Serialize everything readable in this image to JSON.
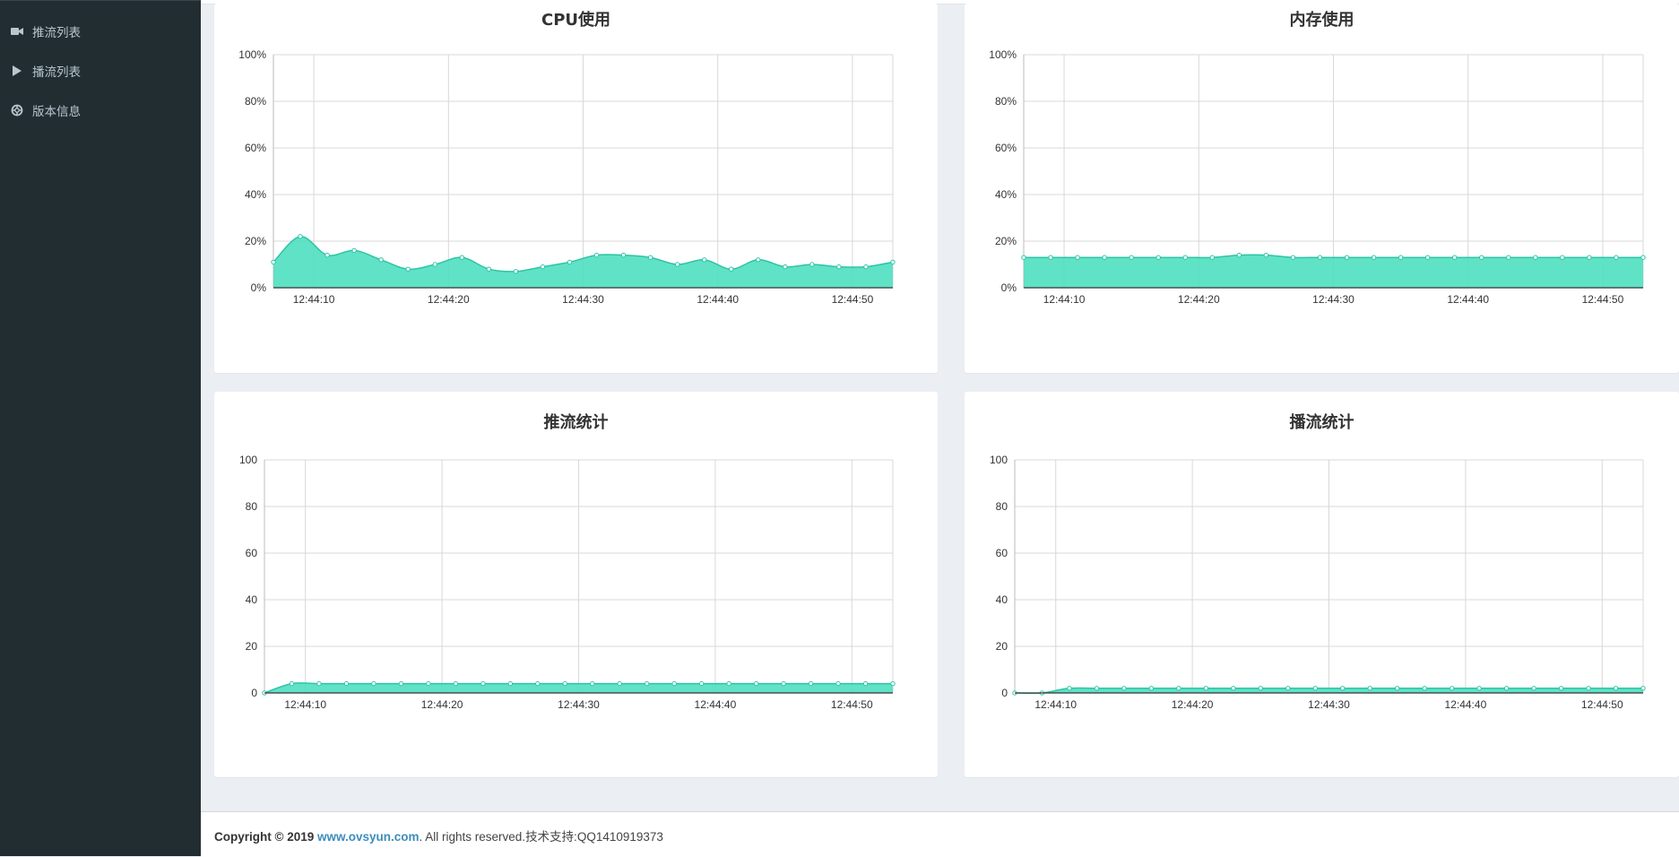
{
  "sidebar": {
    "items": [
      {
        "label": "推流列表",
        "icon": "video-camera-icon"
      },
      {
        "label": "播流列表",
        "icon": "play-icon"
      },
      {
        "label": "版本信息",
        "icon": "lifebuoy-icon"
      }
    ]
  },
  "colors": {
    "fill": "#4fdfc1",
    "line": "#2ec4a5",
    "grid": "#d8d8d8",
    "sidebar": "#222d32",
    "link": "#3c8dbc"
  },
  "charts": {
    "cpu": {
      "title": "CPU使用"
    },
    "mem": {
      "title": "内存使用"
    },
    "push": {
      "title": "推流统计"
    },
    "play": {
      "title": "播流统计"
    }
  },
  "chart_data": [
    {
      "id": "cpu",
      "type": "area",
      "title": "CPU使用",
      "x_ticks": [
        "12:44:10",
        "12:44:20",
        "12:44:30",
        "12:44:40",
        "12:44:50"
      ],
      "x_tick_seconds": [
        10,
        20,
        30,
        40,
        50
      ],
      "x_range": [
        7,
        53
      ],
      "y_ticks": [
        "0%",
        "20%",
        "40%",
        "60%",
        "80%",
        "100%"
      ],
      "ylim": [
        0,
        100
      ],
      "grid": true,
      "series": [
        {
          "x": [
            7,
            9,
            11,
            13,
            15,
            17,
            19,
            21,
            23,
            25,
            27,
            29,
            31,
            33,
            35,
            37,
            39,
            41,
            43,
            45,
            47,
            49,
            51,
            53
          ],
          "values": [
            11,
            22,
            14,
            16,
            12,
            8,
            10,
            13,
            8,
            7,
            9,
            11,
            14,
            14,
            13,
            10,
            12,
            8,
            12,
            9,
            10,
            9,
            9,
            11
          ]
        }
      ]
    },
    {
      "id": "mem",
      "type": "area",
      "title": "内存使用",
      "x_ticks": [
        "12:44:10",
        "12:44:20",
        "12:44:30",
        "12:44:40",
        "12:44:50"
      ],
      "x_tick_seconds": [
        10,
        20,
        30,
        40,
        50
      ],
      "x_range": [
        7,
        53
      ],
      "y_ticks": [
        "0%",
        "20%",
        "40%",
        "60%",
        "80%",
        "100%"
      ],
      "ylim": [
        0,
        100
      ],
      "grid": true,
      "series": [
        {
          "x": [
            7,
            9,
            11,
            13,
            15,
            17,
            19,
            21,
            23,
            25,
            27,
            29,
            31,
            33,
            35,
            37,
            39,
            41,
            43,
            45,
            47,
            49,
            51,
            53
          ],
          "values": [
            13,
            13,
            13,
            13,
            13,
            13,
            13,
            13,
            14,
            14,
            13,
            13,
            13,
            13,
            13,
            13,
            13,
            13,
            13,
            13,
            13,
            13,
            13,
            13
          ]
        }
      ]
    },
    {
      "id": "push",
      "type": "area",
      "title": "推流统计",
      "x_ticks": [
        "12:44:10",
        "12:44:20",
        "12:44:30",
        "12:44:40",
        "12:44:50"
      ],
      "x_tick_seconds": [
        10,
        20,
        30,
        40,
        50
      ],
      "x_range": [
        7,
        53
      ],
      "y_ticks": [
        "0",
        "20",
        "40",
        "60",
        "80",
        "100"
      ],
      "ylim": [
        0,
        100
      ],
      "grid": true,
      "series": [
        {
          "x": [
            7,
            9,
            11,
            13,
            15,
            17,
            19,
            21,
            23,
            25,
            27,
            29,
            31,
            33,
            35,
            37,
            39,
            41,
            43,
            45,
            47,
            49,
            51,
            53
          ],
          "values": [
            0,
            4,
            4,
            4,
            4,
            4,
            4,
            4,
            4,
            4,
            4,
            4,
            4,
            4,
            4,
            4,
            4,
            4,
            4,
            4,
            4,
            4,
            4,
            4
          ]
        }
      ]
    },
    {
      "id": "play",
      "type": "area",
      "title": "播流统计",
      "x_ticks": [
        "12:44:10",
        "12:44:20",
        "12:44:30",
        "12:44:40",
        "12:44:50"
      ],
      "x_tick_seconds": [
        10,
        20,
        30,
        40,
        50
      ],
      "x_range": [
        7,
        53
      ],
      "y_ticks": [
        "0",
        "20",
        "40",
        "60",
        "80",
        "100"
      ],
      "ylim": [
        0,
        100
      ],
      "grid": true,
      "series": [
        {
          "x": [
            7,
            9,
            11,
            13,
            15,
            17,
            19,
            21,
            23,
            25,
            27,
            29,
            31,
            33,
            35,
            37,
            39,
            41,
            43,
            45,
            47,
            49,
            51,
            53
          ],
          "values": [
            0,
            0,
            2,
            2,
            2,
            2,
            2,
            2,
            2,
            2,
            2,
            2,
            2,
            2,
            2,
            2,
            2,
            2,
            2,
            2,
            2,
            2,
            2,
            2
          ]
        }
      ]
    }
  ],
  "footer": {
    "copyright": "Copyright © 2019 ",
    "link": "www.ovsyun.com",
    "rest": ". All rights reserved.技术支持:QQ1410919373"
  }
}
